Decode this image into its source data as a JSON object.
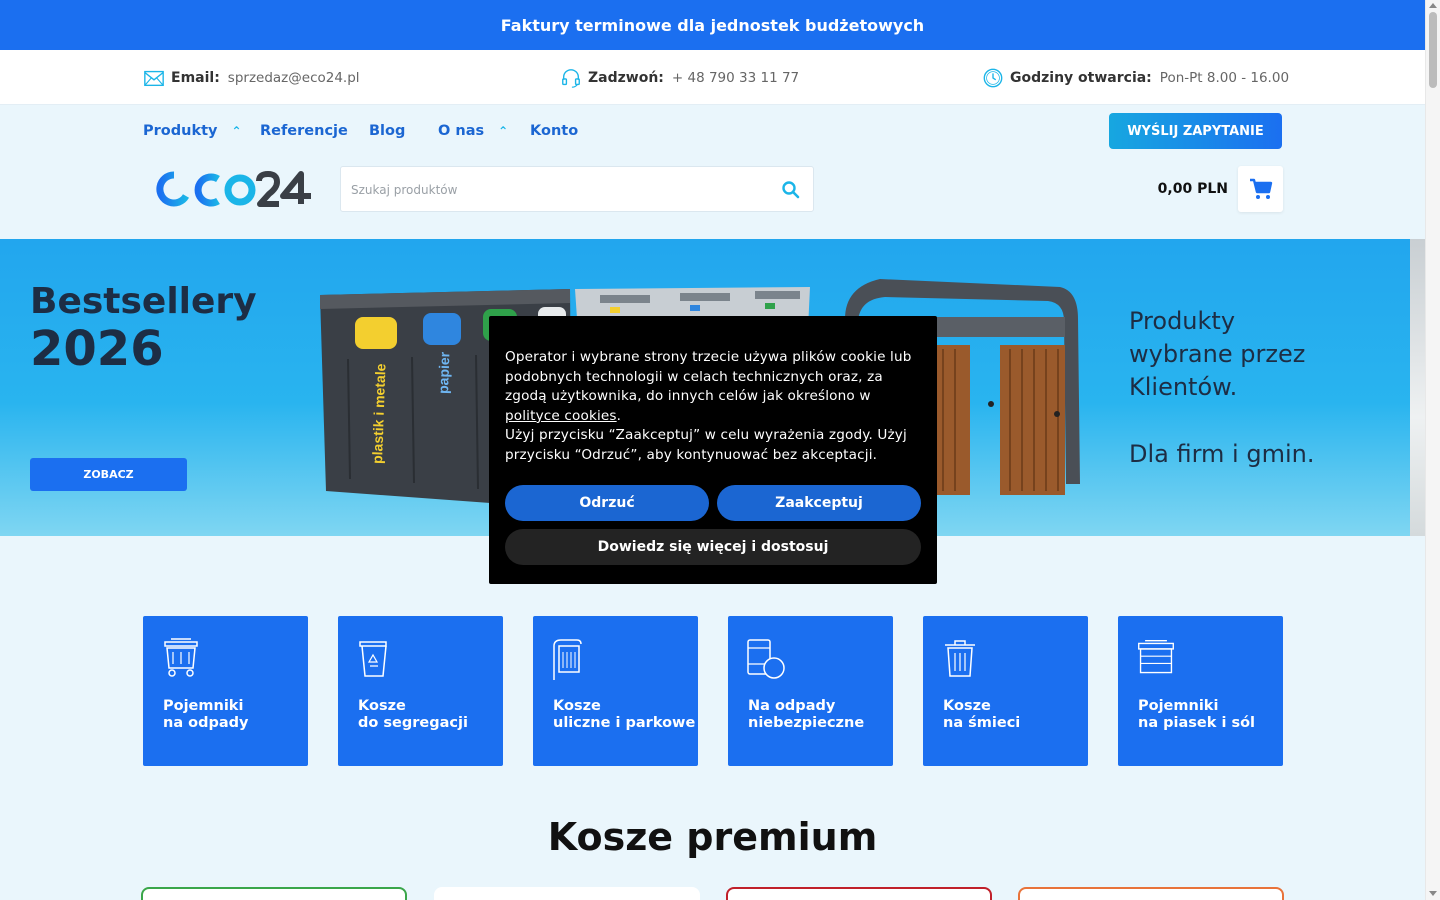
{
  "topbar": {
    "text": "Faktury terminowe dla jednostek budżetowych"
  },
  "contact": {
    "email_label": "Email:",
    "email_value": "sprzedaz@eco24.pl",
    "phone_label": "Zadzwoń:",
    "phone_value": "+ 48 790 33 11 77",
    "hours_label": "Godziny otwarcia:",
    "hours_value": "Pon-Pt 8.00 - 16.00"
  },
  "nav": {
    "items": [
      "Produkty",
      "Referencje",
      "Blog",
      "O nas",
      "Konto"
    ],
    "send_button": "WYŚLIJ ZAPYTANIE"
  },
  "logo": {
    "text": "eco24"
  },
  "search": {
    "placeholder": "Szukaj produktów"
  },
  "cart": {
    "total": "0,00 PLN"
  },
  "hero": {
    "title1": "Bestsellery",
    "title2": "2026",
    "button": "ZOBACZ",
    "text_line1": "Produkty",
    "text_line2": "wybrane przez",
    "text_line3": "Klientów.",
    "text_line4": "Dla firm i gmin.",
    "bin_label1": "plastik i metale",
    "bin_label2": "papier"
  },
  "categories": [
    {
      "line1": "Pojemniki",
      "line2": "na odpady",
      "icon": "waste-container-icon"
    },
    {
      "line1": "Kosze",
      "line2": "do segregacji",
      "icon": "recycling-bin-icon"
    },
    {
      "line1": "Kosze",
      "line2": "uliczne i parkowe",
      "icon": "street-bin-icon"
    },
    {
      "line1": "Na odpady",
      "line2": "niebezpieczne",
      "icon": "hazardous-waste-icon"
    },
    {
      "line1": "Kosze",
      "line2": "na śmieci",
      "icon": "trash-bin-icon"
    },
    {
      "line1": "Pojemniki",
      "line2": "na piasek i sól",
      "icon": "sand-salt-container-icon"
    }
  ],
  "section": {
    "title": "Kosze premium"
  },
  "cookie": {
    "text_part1": "Operator i wybrane strony trzecie używa plików cookie lub podobnych technologii w celach technicznych oraz, za zgodą użytkownika, do innych celów jak określono w ",
    "link": "polityce cookies",
    "text_part2": ".",
    "text_part3": "Użyj przycisku “Zaakceptuj” w celu wyrażenia zgody. Użyj przycisku “Odrzuć”, aby kontynuować bez akceptacji.",
    "reject": "Odrzuć",
    "accept": "Zaakceptuj",
    "more": "Dowiedz się więcej i dostosuj"
  },
  "colors": {
    "brand_blue": "#1b6ff0",
    "link_blue": "#1b66d2",
    "accent_cyan": "#1bb5e8",
    "page_bg": "#eaf6fc",
    "card_border_green": "#3aa64a",
    "card_border_red": "#c0202a",
    "card_border_orange": "#e8733a"
  }
}
